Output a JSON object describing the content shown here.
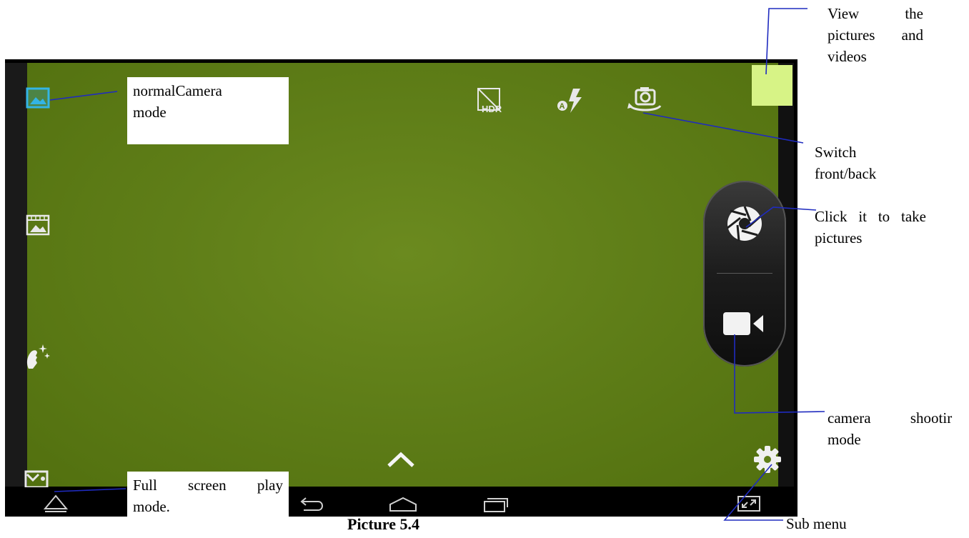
{
  "annotations": {
    "normal_camera_line1": "normalCamera",
    "normal_camera_line2": "mode",
    "view_line1": "View the",
    "view_line2": "pictures and",
    "view_line3": "videos",
    "switch_line1": "Switch",
    "switch_line2": "front/back",
    "take_line1": "Click it to take",
    "take_line2": "pictures",
    "camera_shooting_line1": "camera shootir",
    "camera_shooting_line2": "mode",
    "full_screen_line1": "Full screen play",
    "full_screen_line2": "mode.",
    "sub_menu": "Sub menu"
  },
  "caption": "Picture 5.4",
  "colors": {
    "viewfinder": "#5f7e18",
    "thumbnail": "#d7f386",
    "callout_line": "#1f2bbf",
    "active_mode_icon": "#33b5e5"
  },
  "icons": {
    "mode_photo": "photo-mode-icon",
    "mode_panorama": "panorama-mode-icon",
    "mode_face": "face-beauty-mode-icon",
    "mode_other": "scene-mode-icon",
    "hdr": "hdr-off-icon",
    "flash": "flash-auto-icon",
    "switch_camera": "switch-camera-icon",
    "shutter": "shutter-icon",
    "video": "video-record-icon",
    "settings": "gear-icon",
    "expand": "chevron-up-icon",
    "nav_back": "back-icon",
    "nav_home": "home-icon",
    "nav_recents": "recents-icon",
    "nav_hide": "hide-keyboard-icon",
    "fullscreen": "fullscreen-icon"
  }
}
